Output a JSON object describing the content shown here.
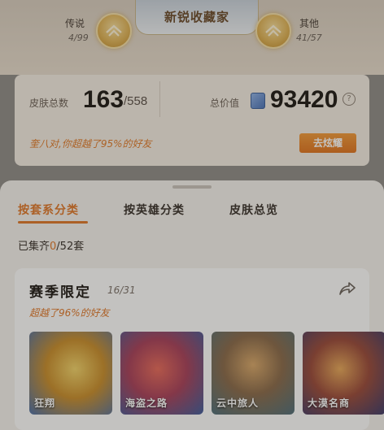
{
  "header": {
    "banner_title": "新锐收藏家",
    "left_tier": {
      "label": "传说",
      "count": "4/99"
    },
    "right_tier": {
      "label": "其他",
      "count": "41/57"
    }
  },
  "summary": {
    "skins_label": "皮肤总数",
    "skins_owned": "163",
    "skins_total": "/558",
    "value_label": "总价值",
    "value": "93420",
    "help_glyph": "?",
    "promo_text": "奎八对,你超越了95%的好友",
    "show_button": "去炫耀"
  },
  "tabs": [
    {
      "label": "按套系分类",
      "active": true
    },
    {
      "label": "按英雄分类",
      "active": false
    },
    {
      "label": "皮肤总览",
      "active": false
    }
  ],
  "progress": {
    "prefix": "已集齐",
    "owned": "0",
    "suffix": "/52套"
  },
  "series": {
    "title": "赛季限定",
    "count": "16/31",
    "subtitle": "超越了96%的好友",
    "skins": [
      {
        "name": "狂翔"
      },
      {
        "name": "海盗之路"
      },
      {
        "name": "云中旅人"
      },
      {
        "name": "大漠名商"
      }
    ]
  }
}
